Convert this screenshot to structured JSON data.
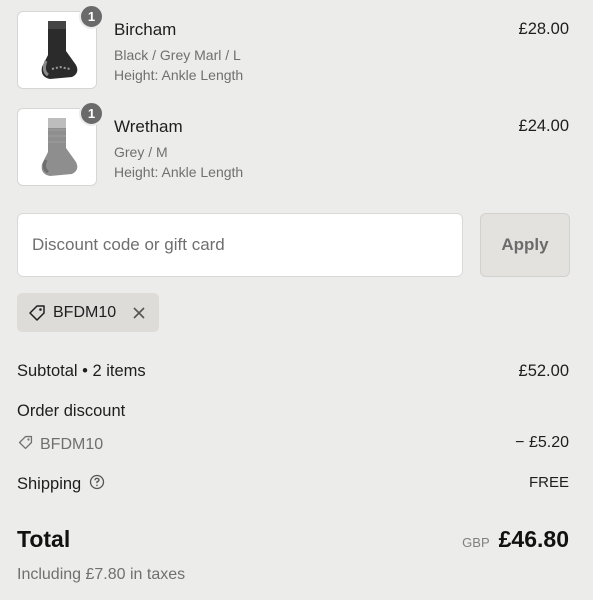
{
  "items": [
    {
      "quantity": "1",
      "name": "Bircham",
      "variant": "Black / Grey Marl / L",
      "height": "Height: Ankle Length",
      "price": "£28.00",
      "sock_color": "#2b2b2b",
      "accent_color": "#7a7a7a"
    },
    {
      "quantity": "1",
      "name": "Wretham",
      "variant": "Grey / M",
      "height": "Height: Ankle Length",
      "price": "£24.00",
      "sock_color": "#8a8a8a",
      "accent_color": "#b8b8b8"
    }
  ],
  "discount": {
    "placeholder": "Discount code or gift card",
    "value": "",
    "apply_label": "Apply",
    "applied_code": "BFDM10"
  },
  "summary": {
    "subtotal_label": "Subtotal • 2 items",
    "subtotal_value": "£52.00",
    "order_discount_label": "Order discount",
    "discount_code": "BFDM10",
    "discount_value": "− £5.20",
    "shipping_label": "Shipping",
    "shipping_value": "FREE",
    "total_label": "Total",
    "currency": "GBP",
    "total_value": "£46.80",
    "tax_note": "Including £7.80 in taxes"
  },
  "colors": {
    "background": "#ececea",
    "apply_button": "#e3e2df",
    "chip": "#dedcd9",
    "badge": "#6a6a6a"
  },
  "icons": {
    "tag": "tag-icon",
    "remove": "close-icon",
    "help": "help-circle-icon"
  }
}
